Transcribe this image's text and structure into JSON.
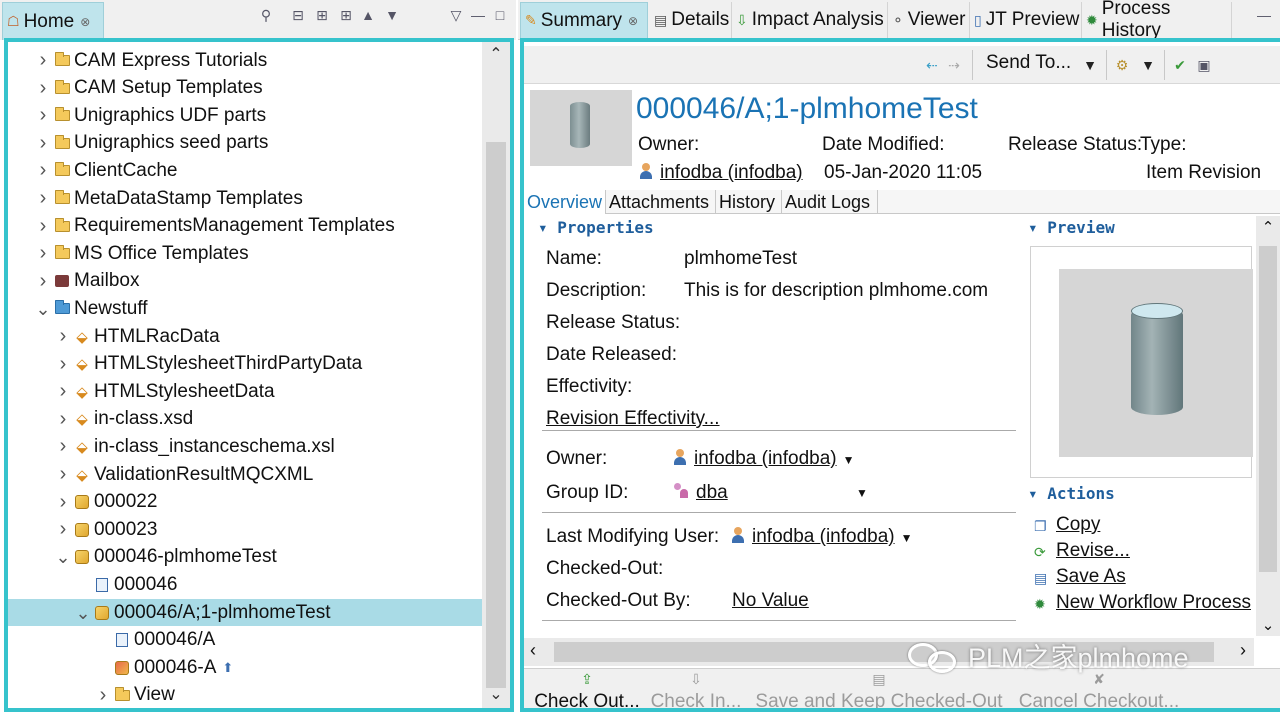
{
  "left": {
    "tab_title": "Home",
    "tree": [
      {
        "label": "CAM Express Tutorials",
        "icon": "folder-icon",
        "depth": 0,
        "expander": "collapsed"
      },
      {
        "label": "CAM Setup Templates",
        "icon": "folder-icon",
        "depth": 0,
        "expander": "collapsed"
      },
      {
        "label": "Unigraphics UDF parts",
        "icon": "folder-icon",
        "depth": 0,
        "expander": "collapsed"
      },
      {
        "label": "Unigraphics seed parts",
        "icon": "folder-icon",
        "depth": 0,
        "expander": "collapsed"
      },
      {
        "label": "ClientCache",
        "icon": "folder-icon",
        "depth": 0,
        "expander": "collapsed"
      },
      {
        "label": "MetaDataStamp Templates",
        "icon": "folder-icon",
        "depth": 0,
        "expander": "collapsed"
      },
      {
        "label": "RequirementsManagement Templates",
        "icon": "folder-icon",
        "depth": 0,
        "expander": "collapsed"
      },
      {
        "label": "MS Office Templates",
        "icon": "folder-icon",
        "depth": 0,
        "expander": "collapsed"
      },
      {
        "label": "Mailbox",
        "icon": "mailbox-icon",
        "depth": 0,
        "expander": "collapsed"
      },
      {
        "label": "Newstuff",
        "icon": "newstuff-folder-icon",
        "depth": 0,
        "expander": "expanded"
      },
      {
        "label": "HTMLRacData",
        "icon": "dataset-icon",
        "depth": 1,
        "expander": "collapsed"
      },
      {
        "label": "HTMLStylesheetThirdPartyData",
        "icon": "dataset-icon",
        "depth": 1,
        "expander": "collapsed"
      },
      {
        "label": "HTMLStylesheetData",
        "icon": "dataset-icon",
        "depth": 1,
        "expander": "collapsed"
      },
      {
        "label": "in-class.xsd",
        "icon": "dataset-icon",
        "depth": 1,
        "expander": "collapsed"
      },
      {
        "label": "in-class_instanceschema.xsl",
        "icon": "dataset-icon",
        "depth": 1,
        "expander": "collapsed"
      },
      {
        "label": "ValidationResultMQCXML",
        "icon": "dataset-icon",
        "depth": 1,
        "expander": "collapsed"
      },
      {
        "label": "000022",
        "icon": "item-icon",
        "depth": 1,
        "expander": "collapsed"
      },
      {
        "label": "000023",
        "icon": "item-icon",
        "depth": 1,
        "expander": "collapsed"
      },
      {
        "label": "000046-plmhomeTest",
        "icon": "item-icon",
        "depth": 1,
        "expander": "expanded"
      },
      {
        "label": "000046",
        "icon": "form-icon",
        "depth": 2,
        "expander": "none"
      },
      {
        "label": "000046/A;1-plmhomeTest",
        "icon": "item-revision-icon",
        "depth": 2,
        "expander": "expanded",
        "selected": true
      },
      {
        "label": "000046/A",
        "icon": "form-icon",
        "depth": 3,
        "expander": "none"
      },
      {
        "label": "000046-A",
        "icon": "part-icon",
        "depth": 3,
        "expander": "none",
        "badge": "upload-icon"
      },
      {
        "label": "View",
        "icon": "folder-icon",
        "depth": 3,
        "expander": "collapsed"
      }
    ]
  },
  "right": {
    "tabs": [
      {
        "label": "Summary",
        "icon": "summary-icon",
        "active": true
      },
      {
        "label": "Details",
        "icon": "details-icon"
      },
      {
        "label": "Impact Analysis",
        "icon": "impact-analysis-icon"
      },
      {
        "label": "Viewer",
        "icon": "viewer-icon"
      },
      {
        "label": "JT Preview",
        "icon": "jt-preview-icon"
      },
      {
        "label": "Process History",
        "icon": "process-history-icon"
      }
    ],
    "toolbar": {
      "send_to": "Send To..."
    },
    "header": {
      "title": "000046/A;1-plmhomeTest",
      "owner_label": "Owner:",
      "owner_value": "infodba (infodba)",
      "date_modified_label": "Date Modified:",
      "date_modified_value": "05-Jan-2020 11:05",
      "release_status_label": "Release Status:",
      "type_label": "Type:",
      "type_value": "Item Revision"
    },
    "subtabs": [
      "Overview",
      "Attachments",
      "History",
      "Audit Logs"
    ],
    "properties": {
      "section_title": "Properties",
      "name_label": "Name:",
      "name_value": "plmhomeTest",
      "description_label": "Description:",
      "description_value": "This is for description plmhome.com",
      "release_status_label": "Release Status:",
      "date_released_label": "Date Released:",
      "effectivity_label": "Effectivity:",
      "revision_effectivity": "Revision Effectivity...",
      "owner_label": "Owner:",
      "owner_value": "infodba (infodba)",
      "group_label": "Group ID:",
      "group_value": "dba",
      "last_mod_label": "Last Modifying User:",
      "last_mod_value": "infodba (infodba)",
      "checked_out_label": "Checked-Out:",
      "checked_out_by_label": "Checked-Out By:",
      "checked_out_by_value": "No Value"
    },
    "preview": {
      "section_title": "Preview"
    },
    "actions": {
      "section_title": "Actions",
      "items": [
        "Copy",
        "Revise...",
        "Save As",
        "New Workflow Process"
      ]
    },
    "bottom_bar": {
      "check_out": "Check Out...",
      "check_in": "Check In...",
      "save_keep": "Save and Keep Checked-Out",
      "cancel_checkout": "Cancel Checkout..."
    }
  },
  "watermark": "PLM之家plmhome",
  "colors": {
    "accent": "#36c3cc",
    "selection": "#a9dbe6",
    "title_blue": "#1a73b4",
    "section_blue": "#1f5e9c"
  }
}
